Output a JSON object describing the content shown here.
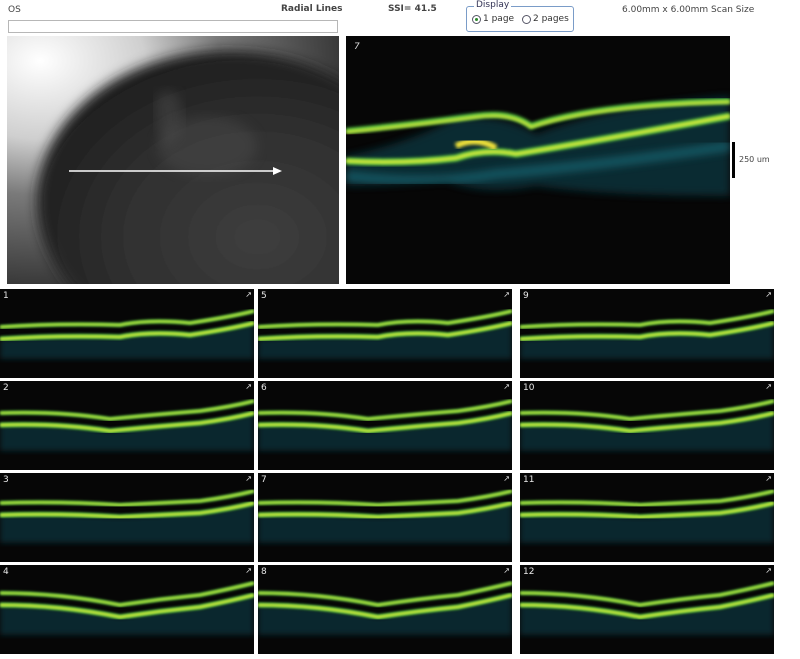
{
  "header": {
    "eye": "OS",
    "scan_pattern": "Radial Lines",
    "ssi": "SSI= 41.5",
    "display_group": "Display",
    "display_options": [
      "1 page",
      "2 pages"
    ],
    "scan_size": "6.00mm x 6.00mm Scan Size"
  },
  "main_scan": {
    "number": "7",
    "scale_label": "250 um"
  },
  "thumbnails": [
    {
      "number": "1"
    },
    {
      "number": "2"
    },
    {
      "number": "3"
    },
    {
      "number": "4"
    },
    {
      "number": "5"
    },
    {
      "number": "6"
    },
    {
      "number": "7"
    },
    {
      "number": "8"
    },
    {
      "number": "9"
    },
    {
      "number": "10"
    },
    {
      "number": "11"
    },
    {
      "number": "12"
    }
  ],
  "colors": {
    "retina_yellow": "#e9f23a",
    "retina_green": "#5fcf3e",
    "retina_cyan": "#2d8f9e",
    "background": "#060606"
  }
}
